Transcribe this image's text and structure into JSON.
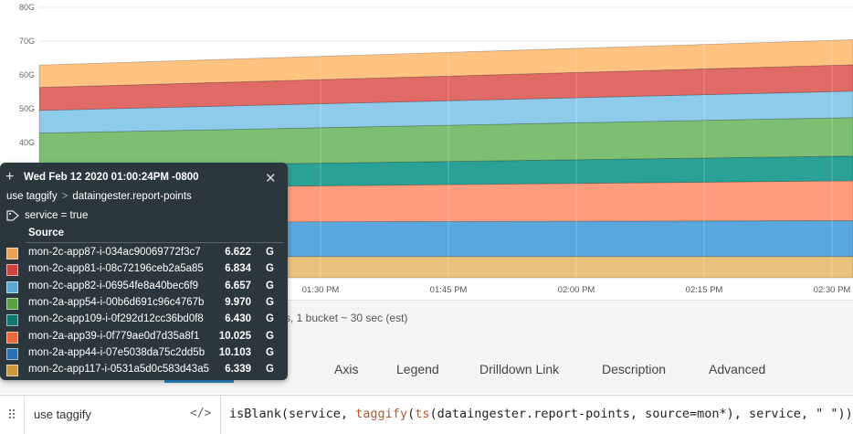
{
  "chart_data": {
    "type": "area",
    "stacked": true,
    "y_ticks": [
      "80G",
      "70G",
      "60G",
      "50G",
      "40G"
    ],
    "x_ticks": [
      "01:30 PM",
      "01:45 PM",
      "02:00 PM",
      "02:15 PM",
      "02:30 PM"
    ],
    "series": [
      {
        "color": "#e9c27e",
        "start": 6.3,
        "end": 6.3
      },
      {
        "color": "#5aa7dd",
        "start": 10.1,
        "end": 10.6
      },
      {
        "color": "#ff9c7d",
        "start": 10.0,
        "end": 11.8
      },
      {
        "color": "#2aa196",
        "start": 6.4,
        "end": 7.3
      },
      {
        "color": "#7cbe72",
        "start": 10.0,
        "end": 11.4
      },
      {
        "color": "#8ecbeb",
        "start": 6.7,
        "end": 7.8
      },
      {
        "color": "#e06a66",
        "start": 6.8,
        "end": 7.8
      },
      {
        "color": "#ffc381",
        "start": 6.6,
        "end": 7.4
      }
    ]
  },
  "status": {
    "text": "s, 1 bucket ~ 30 sec (est)"
  },
  "tabs": [
    {
      "label": "at"
    },
    {
      "label": "Axis"
    },
    {
      "label": "Legend"
    },
    {
      "label": "Drilldown Link"
    },
    {
      "label": "Description"
    },
    {
      "label": "Advanced"
    }
  ],
  "query": {
    "name": "use taggify",
    "toggle": "</>",
    "expr_p1": "isBlank(service, ",
    "expr_kw1": "taggify",
    "expr_p2": "(",
    "expr_kw2": "ts",
    "expr_p3": "(dataingester.report-points, source=mon*), service, \" \"))"
  },
  "tooltip": {
    "timestamp": "Wed Feb 12 2020 01:00:24PM -0800",
    "query_name": "use taggify",
    "separator": ">",
    "metric": "dataingester.report-points",
    "tag": "service = true",
    "source_header": "Source",
    "rows": [
      {
        "source": "mon-2c-app87-i-034ac90069772f3c7",
        "value": "6.622",
        "unit": "G",
        "color": "#e9a35a"
      },
      {
        "source": "mon-2c-app81-i-08c72196ceb2a5a85",
        "value": "6.834",
        "unit": "G",
        "color": "#c9453f"
      },
      {
        "source": "mon-2c-app82-i-06954fe8a40bec6f9",
        "value": "6.657",
        "unit": "G",
        "color": "#5fa7d3"
      },
      {
        "source": "mon-2a-app54-i-00b6d691c96c4767b",
        "value": "9.970",
        "unit": "G",
        "color": "#5c9e46"
      },
      {
        "source": "mon-2c-app109-i-0f292d12cc36bd0f8",
        "value": "6.430",
        "unit": "G",
        "color": "#13756d"
      },
      {
        "source": "mon-2a-app39-i-0f779ae0d7d35a8f1",
        "value": "10.025",
        "unit": "G",
        "color": "#e76a3c"
      },
      {
        "source": "mon-2a-app44-i-07e5038da75c2dd5b",
        "value": "10.103",
        "unit": "G",
        "color": "#2c6fae"
      },
      {
        "source": "mon-2c-app117-i-0531a5d0c583d43a5",
        "value": "6.339",
        "unit": "G",
        "color": "#c99a3f"
      }
    ]
  }
}
